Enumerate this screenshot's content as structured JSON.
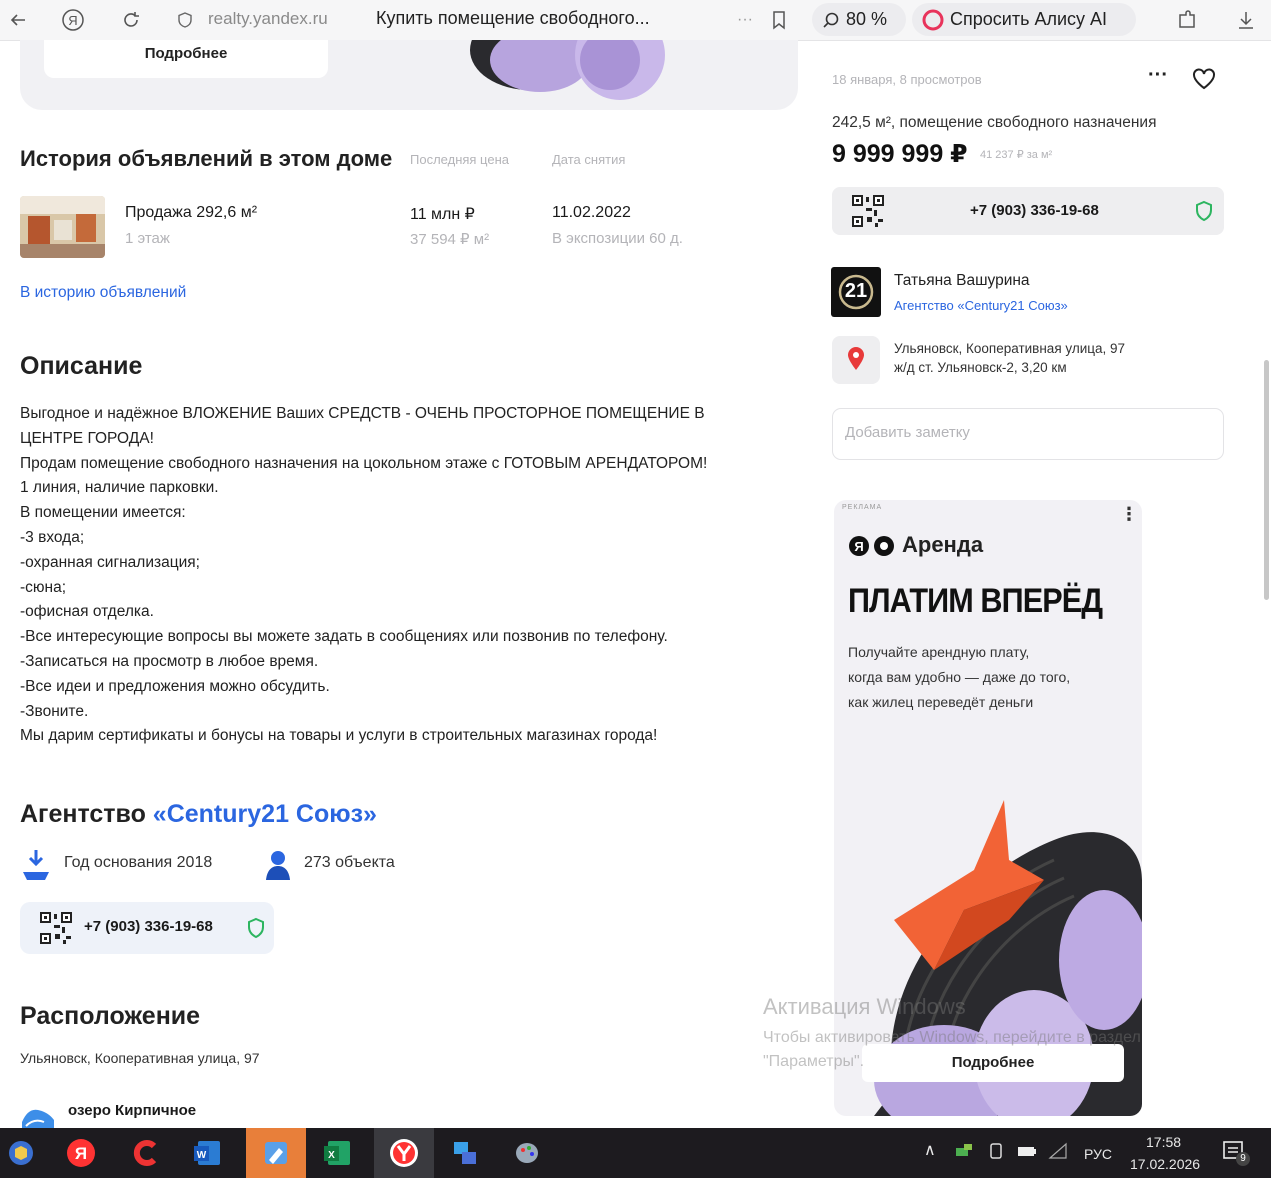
{
  "browser": {
    "domain": "realty.yandex.ru",
    "title": "Купить помещение свободного...",
    "zoom": "80 %",
    "alice": "Спросить Алису AI"
  },
  "promo": {
    "more": "Подробнее"
  },
  "history": {
    "heading": "История объявлений в этом доме",
    "col_price": "Последняя цена",
    "col_date": "Дата снятия",
    "item_title": "Продажа 292,6 м²",
    "item_floor": "1 этаж",
    "price": "11 млн ₽",
    "price_m2": "37 594 ₽ м²",
    "date": "11.02.2022",
    "exposure": "В экспозиции 60 д.",
    "link": "В историю объявлений"
  },
  "description": {
    "heading": "Описание",
    "lines": [
      "Выгодное и надёжное ВЛОЖЕНИЕ Ваших СРЕДСТВ - ОЧЕНЬ ПРОСТОРНОЕ ПОМЕЩЕНИЕ В",
      "ЦЕНТРЕ ГОРОДА!",
      "Продам помещение свободного назначения на цокольном этаже с ГОТОВЫМ АРЕНДАТОРОМ!",
      "1 линия, наличие парковки.",
      "В помещении имеется:",
      "-3 входа;",
      "-охранная сигнализация;",
      "-сюна;",
      "-офисная отделка.",
      "-Все интересующие вопросы вы можете задать в сообщениях или позвонив по телефону.",
      "-Записаться на просмотр в любое время.",
      "-Все идеи и предложения можно обсудить.",
      "-Звоните.",
      "Мы дарим сертификаты и бонусы на товары и услуги в строительных магазинах города!"
    ]
  },
  "agency": {
    "heading_prefix": "Агентство",
    "heading_name": "«Century21 Союз»",
    "founded": "Год основания 2018",
    "objects": "273 объекта",
    "phone": "+7 (903) 336-19-68"
  },
  "location": {
    "heading": "Расположение",
    "address": "Ульяновск, Кооперативная улица, 97",
    "nearby": "озеро Кирпичное"
  },
  "listing": {
    "meta": "18 января, 8 просмотров",
    "summary": "242,5 м², помещение свободного назначения",
    "price": "9 999 999 ₽",
    "price_m2": "41 237 ₽ за м²",
    "phone": "+7 (903) 336-19-68",
    "agent_name": "Татьяна Вашурина",
    "agent_agency": "Агентство «Century21 Союз»",
    "agent_logo": "21",
    "addr1": "Ульяновск, Кооперативная улица, 97",
    "addr2": "ж/д ст. Ульяновск-2, 3,20 км",
    "note_placeholder": "Добавить заметку"
  },
  "ad": {
    "tag": "РЕКЛАМА",
    "brand": "Аренда",
    "headline": "ПЛАТИМ ВПЕРЁД",
    "text1": "Получайте арендную плату,",
    "text2": "когда вам удобно — даже до того,",
    "text3": "как жилец переведёт деньги",
    "button": "Подробнее"
  },
  "watermark": {
    "title": "Активация Windows",
    "line1": "Чтобы активировать Windows, перейдите в раздел",
    "line2": "\"Параметры\"."
  },
  "taskbar": {
    "lang": "РУС",
    "time": "17:58",
    "date": "17.02.2026",
    "notif": "9"
  },
  "colors": {
    "accent": "#2b66e0",
    "ad_bg": "#f2f1f5",
    "taskbar": "#1d1b1f",
    "shield": "#2db560"
  }
}
